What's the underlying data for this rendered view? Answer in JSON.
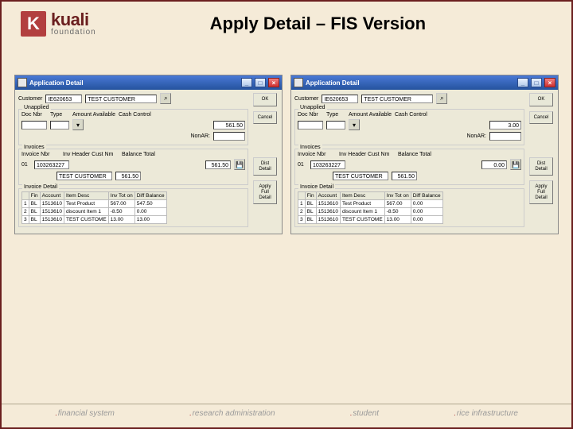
{
  "logo": {
    "mark": "K",
    "main": "kuali",
    "sub": "foundation"
  },
  "page_title": "Apply Detail – FIS Version",
  "windows": [
    {
      "title": "Application Detail",
      "customer": {
        "label": "Customer",
        "code": "IE620653",
        "name": "TEST CUSTOMER"
      },
      "unapplied": {
        "title": "Unapplied",
        "headers": {
          "docnbr": "Doc Nbr",
          "type": "Type",
          "amount": "Amount Available"
        },
        "cashcontrol_label": "Cash Control",
        "cashcontrol_value": "561.50",
        "nonar_label": "NonAR:"
      },
      "invoices": {
        "title": "Invoices",
        "headers": {
          "nbr": "Invoice Nbr",
          "cust": "Inv Header Cust Nm",
          "bal": "Balance Total"
        },
        "row": {
          "idx": "01",
          "nbr": "103263227",
          "cust": "TEST CUSTOMER",
          "bal1": "561.50",
          "bal2": "561.50"
        }
      },
      "detail": {
        "title": "Invoice Detail",
        "headers": {
          "fin": "Fin",
          "acct": "Account",
          "item": "Item Desc",
          "inv": "Inv Tot on",
          "diff": "Diff Balance"
        },
        "rows": [
          {
            "n": "1",
            "fin": "BL",
            "acct": "1513610",
            "desc": "Test Product",
            "inv": "567.00",
            "diff": "547.50"
          },
          {
            "n": "2",
            "fin": "BL",
            "acct": "1513610",
            "desc": "discount Item 1",
            "inv": "-8.50",
            "diff": "0.00"
          },
          {
            "n": "3",
            "fin": "BL",
            "acct": "1513610",
            "desc": "TEST CUSTOME",
            "inv": "13.00",
            "diff": "13.00"
          }
        ]
      },
      "buttons": {
        "ok": "OK",
        "cancel": "Cancel",
        "dist": "Dist Detail",
        "apply": "Apply Full Detail"
      }
    },
    {
      "title": "Application Detail",
      "customer": {
        "label": "Customer",
        "code": "IE620653",
        "name": "TEST CUSTOMER"
      },
      "unapplied": {
        "title": "Unapplied",
        "headers": {
          "docnbr": "Doc Nbr",
          "type": "Type",
          "amount": "Amount Available"
        },
        "cashcontrol_label": "Cash Control",
        "cashcontrol_value": "3.00",
        "nonar_label": "NonAR:"
      },
      "invoices": {
        "title": "Invoices",
        "headers": {
          "nbr": "Invoice Nbr",
          "cust": "Inv Header Cust Nm",
          "bal": "Balance Total"
        },
        "row": {
          "idx": "01",
          "nbr": "103263227",
          "cust": "TEST CUSTOMER",
          "bal1": "0.00",
          "bal2": "561.50"
        }
      },
      "detail": {
        "title": "Invoice Detail",
        "headers": {
          "fin": "Fin",
          "acct": "Account",
          "item": "Item Desc",
          "inv": "Inv Tot on",
          "diff": "Diff Balance"
        },
        "rows": [
          {
            "n": "1",
            "fin": "BL",
            "acct": "1513610",
            "desc": "Test Product",
            "inv": "567.00",
            "diff": "0.00"
          },
          {
            "n": "2",
            "fin": "BL",
            "acct": "1513610",
            "desc": "discount Item 1",
            "inv": "-8.50",
            "diff": "0.00"
          },
          {
            "n": "3",
            "fin": "BL",
            "acct": "1513610",
            "desc": "TEST CUSTOME",
            "inv": "13.00",
            "diff": "0.00"
          }
        ]
      },
      "buttons": {
        "ok": "OK",
        "cancel": "Cancel",
        "dist": "Dist Detail",
        "apply": "Apply Full Detail"
      }
    }
  ],
  "footer": {
    "a": "financial system",
    "b": "research administration",
    "c": "student",
    "d": "rice infrastructure"
  }
}
